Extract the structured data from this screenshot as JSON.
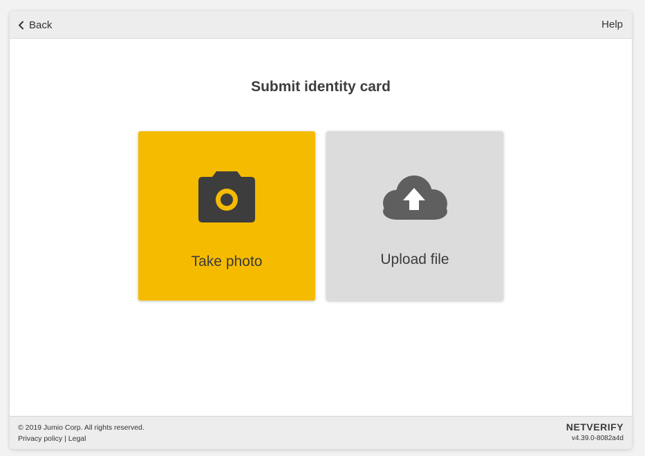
{
  "topbar": {
    "back_label": "Back",
    "back_icon": "chevron-left-icon",
    "help_label": "Help"
  },
  "main": {
    "title": "Submit identity card",
    "options": [
      {
        "label": "Take photo",
        "icon": "camera-icon",
        "color": "#f5bb00"
      },
      {
        "label": "Upload file",
        "icon": "cloud-upload-icon",
        "color": "#dcdcdc"
      }
    ]
  },
  "footer": {
    "copyright": "© 2019 Jumio Corp. All rights reserved.",
    "privacy_label": "Privacy policy",
    "separator": "|",
    "legal_label": "Legal",
    "brand": "NETVERIFY",
    "version": "v4.39.0-8082a4d"
  },
  "colors": {
    "accent": "#f5bb00",
    "icon_dark": "#3d3d3d",
    "icon_gray": "#5f5f5f"
  }
}
